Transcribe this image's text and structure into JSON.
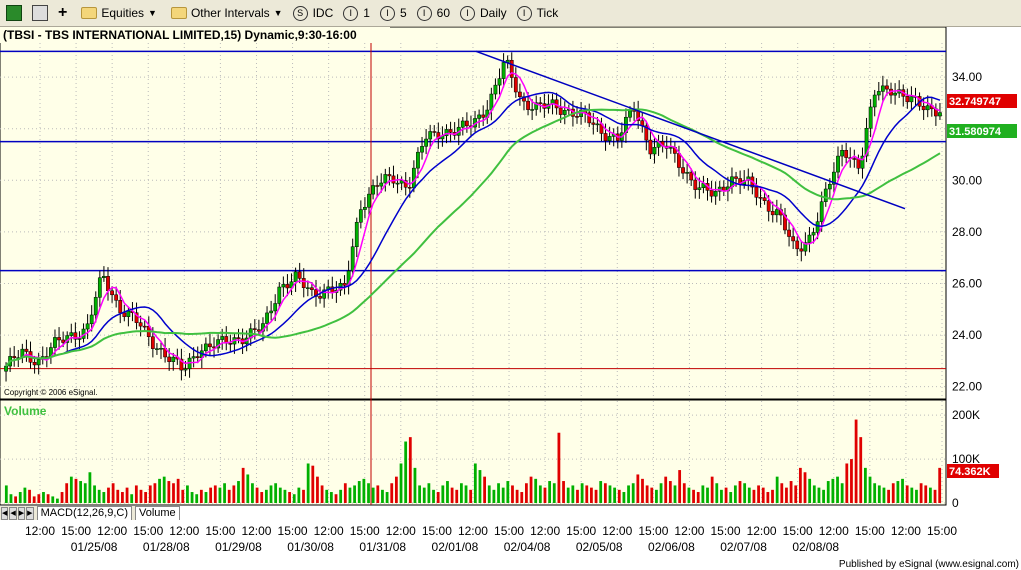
{
  "toolbar": {
    "equities_label": "Equities",
    "intervals_label": "Other Intervals",
    "buttons": [
      "IDC",
      "1",
      "5",
      "60",
      "Daily",
      "Tick"
    ],
    "button_icons": [
      "S",
      "I",
      "I",
      "I",
      "I",
      "I"
    ]
  },
  "chart_title": "(TBSI - TBS INTERNATIONAL LIMITED,15) Dynamic,9:30-16:00",
  "copyright": "Copyright © 2006 eSignal.",
  "volume_label": "Volume",
  "price_badges": {
    "last": "32.749747",
    "ma": "31.580974"
  },
  "volume_badge": "74.362K",
  "tabs": [
    "MACD(12,26,9,C)",
    "Volume"
  ],
  "published": "Published by eSignal (www.esignal.com)",
  "colors": {
    "background": "#ffffe8",
    "up": "#00b000",
    "down": "#e00000",
    "horizontal": "#0000c0",
    "ma_fast": "#ff00ff",
    "ma_mid": "#0000cc",
    "ma_slow": "#40c040",
    "vline": "#c00000"
  },
  "chart_data": {
    "type": "candlestick",
    "ylim": [
      21.6,
      35.4
    ],
    "yticks": [
      22,
      24,
      26,
      28,
      30,
      32,
      34
    ],
    "volume_ylim": [
      0,
      230
    ],
    "volume_ticks": [
      {
        "v": 0,
        "label": "0"
      },
      {
        "v": 100,
        "label": "100K"
      },
      {
        "v": 200,
        "label": "200K"
      }
    ],
    "xticks": [
      "12:00",
      "15:00",
      "12:00",
      "15:00",
      "12:00",
      "15:00",
      "12:00",
      "15:00",
      "12:00",
      "15:00",
      "12:00",
      "15:00",
      "12:00",
      "15:00",
      "12:00",
      "15:00",
      "12:00",
      "15:00",
      "12:00",
      "15:00",
      "12:00",
      "15:00",
      "12:00",
      "15:00",
      "12:00",
      "15:00"
    ],
    "dates": [
      "01/25/08",
      "01/28/08",
      "01/29/08",
      "01/30/08",
      "01/31/08",
      "02/01/08",
      "02/04/08",
      "02/05/08",
      "02/06/08",
      "02/07/08",
      "02/08/08"
    ],
    "horizontal_lines": [
      35.0,
      31.5,
      26.5,
      22.7
    ],
    "trendline": [
      [
        35.0,
        0
      ],
      [
        28.9,
        1
      ]
    ],
    "close_points": [
      22.8,
      23.3,
      23.0,
      23.6,
      24.0,
      24.2,
      26.3,
      25.1,
      24.6,
      23.8,
      23.2,
      22.6,
      23.5,
      23.6,
      23.8,
      24.0,
      24.3,
      25.9,
      26.2,
      25.6,
      25.8,
      25.7,
      29.0,
      29.8,
      30.1,
      29.8,
      31.6,
      31.9,
      31.9,
      32.2,
      33.0,
      34.6,
      33.1,
      32.8,
      32.9,
      32.7,
      32.4,
      31.9,
      31.6,
      32.8,
      31.3,
      31.3,
      30.5,
      29.7,
      29.4,
      30.1,
      29.9,
      29.2,
      28.7,
      27.2,
      27.9,
      29.6,
      31.3,
      30.5,
      33.5,
      33.6,
      33.1,
      32.9,
      32.7
    ],
    "volumes": [
      40,
      20,
      15,
      25,
      35,
      30,
      15,
      20,
      25,
      20,
      15,
      10,
      25,
      45,
      60,
      55,
      50,
      45,
      70,
      40,
      30,
      25,
      35,
      45,
      30,
      25,
      35,
      20,
      40,
      30,
      25,
      40,
      45,
      55,
      60,
      50,
      45,
      55,
      30,
      40,
      25,
      20,
      30,
      25,
      35,
      40,
      35,
      45,
      30,
      40,
      50,
      80,
      65,
      45,
      35,
      25,
      30,
      40,
      45,
      35,
      30,
      25,
      20,
      35,
      30,
      90,
      85,
      60,
      40,
      30,
      25,
      20,
      30,
      45,
      35,
      40,
      50,
      55,
      45,
      35,
      40,
      30,
      25,
      45,
      60,
      90,
      140,
      150,
      80,
      40,
      35,
      45,
      30,
      25,
      40,
      50,
      35,
      30,
      45,
      40,
      30,
      90,
      75,
      60,
      40,
      30,
      45,
      35,
      50,
      40,
      30,
      25,
      45,
      60,
      55,
      40,
      35,
      50,
      45,
      160,
      50,
      35,
      40,
      30,
      45,
      40,
      35,
      30,
      50,
      45,
      40,
      35,
      30,
      25,
      40,
      45,
      65,
      55,
      40,
      35,
      30,
      45,
      60,
      50,
      40,
      75,
      45,
      35,
      30,
      25,
      40,
      35,
      60,
      45,
      30,
      35,
      25,
      40,
      50,
      45,
      35,
      30,
      40,
      35,
      25,
      30,
      60,
      45,
      35,
      50,
      40,
      80,
      70,
      55,
      40,
      35,
      30,
      50,
      55,
      60,
      45,
      90,
      100,
      190,
      150,
      80,
      60,
      45,
      40,
      35,
      30,
      45,
      50,
      55,
      40,
      35,
      30,
      45,
      40,
      35,
      30,
      80
    ]
  }
}
